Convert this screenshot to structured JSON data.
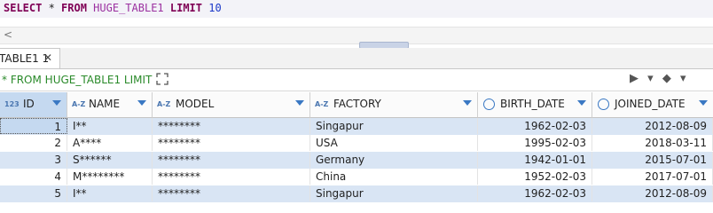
{
  "editor": {
    "sql_keyword_select": "SELECT",
    "sql_star": " * ",
    "sql_keyword_from": "FROM",
    "sql_table": " HUGE_TABLE1 ",
    "sql_keyword_limit": "LIMIT",
    "sql_number": " 10"
  },
  "scrollbar": {
    "left_arrow": "<"
  },
  "tab": {
    "label": "TABLE1 1",
    "close": "✕"
  },
  "filter": {
    "text": "* FROM HUGE_TABLE1 LIMIT 10",
    "expand_icon": "expand-icon"
  },
  "colors": {
    "stripe": "#d9e5f4",
    "selected": "#c5d9f0",
    "keyword": "#7f0055",
    "filter_text": "#2a8a2a"
  },
  "table": {
    "columns": [
      {
        "type": "123",
        "name": "ID"
      },
      {
        "type": "A-Z",
        "name": "NAME"
      },
      {
        "type": "A-Z",
        "name": "MODEL"
      },
      {
        "type": "A-Z",
        "name": "FACTORY"
      },
      {
        "type": "clock",
        "name": "BIRTH_DATE"
      },
      {
        "type": "clock",
        "name": "JOINED_DATE"
      }
    ],
    "rows": [
      [
        "1",
        "I**",
        "********",
        "Singapur",
        "1962-02-03",
        "2012-08-09"
      ],
      [
        "2",
        "A****",
        "********",
        "USA",
        "1995-02-03",
        "2018-03-11"
      ],
      [
        "3",
        "S******",
        "********",
        "Germany",
        "1942-01-01",
        "2015-07-01"
      ],
      [
        "4",
        "M********",
        "********",
        "China",
        "1952-02-03",
        "2017-07-01"
      ],
      [
        "5",
        "I**",
        "********",
        "Singapur",
        "1962-02-03",
        "2012-08-09"
      ]
    ]
  }
}
